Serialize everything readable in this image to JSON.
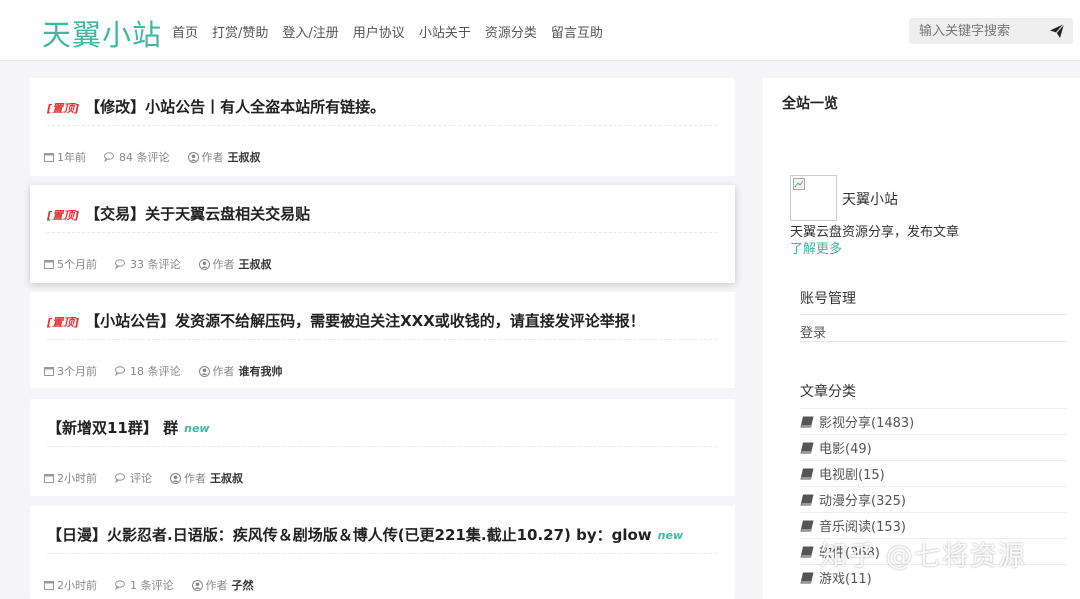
{
  "header": {
    "logo": "天翼小站",
    "nav": [
      "首页",
      "打赏/赞助",
      "登入/注册",
      "用户协议",
      "小站关于",
      "资源分类",
      "留言互助"
    ],
    "search_placeholder": "输入关键字搜索"
  },
  "posts": [
    {
      "tag": "[置顶]",
      "title": "【修改】小站公告丨有人全盗本站所有链接。",
      "new": "",
      "time": "1年前",
      "comments": "84 条评论",
      "author_label": "作者",
      "author": "王叔叔"
    },
    {
      "tag": "[置顶]",
      "title": "【交易】关于天翼云盘相关交易贴",
      "new": "",
      "time": "5个月前",
      "comments": "33 条评论",
      "author_label": "作者",
      "author": "王叔叔"
    },
    {
      "tag": "[置顶]",
      "title": "【小站公告】发资源不给解压码，需要被迫关注XXX或收钱的，请直接发评论举报！",
      "new": "",
      "time": "3个月前",
      "comments": "18 条评论",
      "author_label": "作者",
      "author": "谁有我帅"
    },
    {
      "tag": "",
      "title": "【新增双11群】 群",
      "new": "new",
      "time": "2小时前",
      "comments": "评论",
      "author_label": "作者",
      "author": "王叔叔"
    },
    {
      "tag": "",
      "title": "【日漫】火影忍者.日语版：疾风传＆剧场版＆博人传(已更221集.截止10.27) by：glow",
      "new": "new",
      "time": "2小时前",
      "comments": "1 条评论",
      "author_label": "作者",
      "author": "子然"
    }
  ],
  "sidebar": {
    "title": "全站一览",
    "site_name": "天翼小站",
    "site_desc": "天翼云盘资源分享，发布文章",
    "learn_more": "了解更多",
    "account_title": "账号管理",
    "login": "登录",
    "categories_title": "文章分类",
    "categories": [
      "影视分享(1483)",
      "电影(49)",
      "电视剧(15)",
      "动漫分享(325)",
      "音乐阅读(153)",
      "软件(368)",
      "游戏(11)"
    ]
  },
  "watermark": "知乎 @七将资源",
  "colors": {
    "accent": "#3fb8a2",
    "sticky_tag": "#e23636"
  },
  "icons": {
    "search_submit": "paper-plane-icon",
    "time": "calendar-icon",
    "comments": "comments-icon",
    "author": "user-circle-icon",
    "category": "book-icon"
  }
}
